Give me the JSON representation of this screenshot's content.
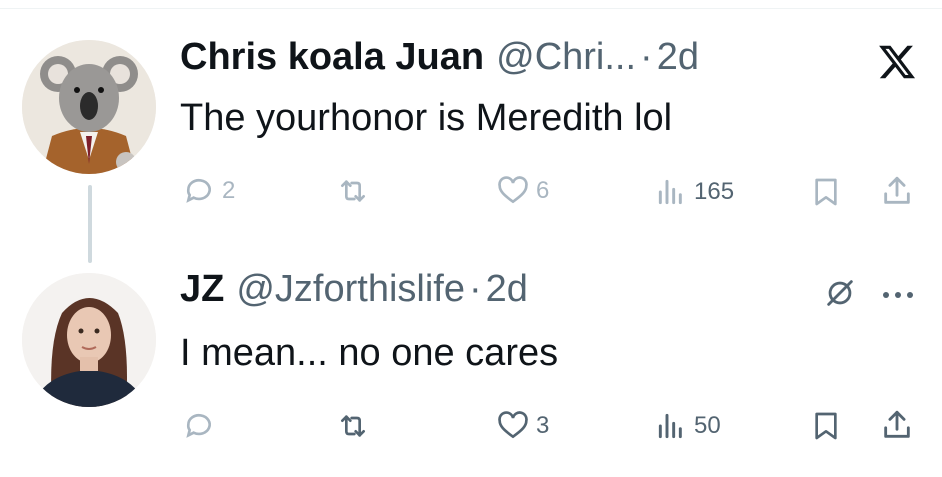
{
  "tweets": [
    {
      "name": "Chris koala Juan",
      "handle": "@Chri...",
      "dot": "·",
      "time": "2d",
      "text": "The yourhonor is Meredith lol",
      "replies": "2",
      "likes": "6",
      "views": "165",
      "source_icon": "x-logo-icon"
    },
    {
      "name": "JZ",
      "handle": "@Jzforthislife",
      "dot": "·",
      "time": "2d",
      "text": "I mean... no one cares",
      "replies": "",
      "likes": "3",
      "views": "50",
      "source_icon": "grok-icon"
    }
  ],
  "colors": {
    "text": "#0f1419",
    "muted": "#536471",
    "faded": "#a9b6c1",
    "thread_line": "#cfd9de"
  }
}
